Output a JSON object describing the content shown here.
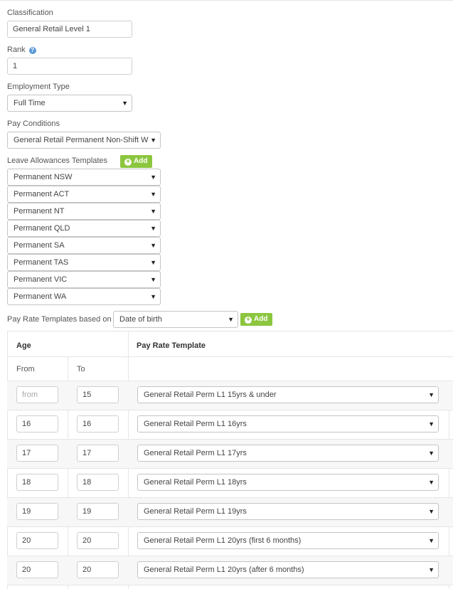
{
  "classification": {
    "label": "Classification",
    "value": "General Retail Level 1"
  },
  "rank": {
    "label": "Rank",
    "help_icon": "?",
    "value": "1"
  },
  "employment_type": {
    "label": "Employment Type",
    "value": "Full Time"
  },
  "pay_conditions": {
    "label": "Pay Conditions",
    "value": "General Retail Permanent Non-Shift W"
  },
  "leave_allowances": {
    "label": "Leave Allowances Templates",
    "add_label": "Add",
    "items": [
      "Permanent NSW",
      "Permanent ACT",
      "Permanent NT",
      "Permanent QLD",
      "Permanent SA",
      "Permanent TAS",
      "Permanent VIC",
      "Permanent WA"
    ]
  },
  "pay_rate_basis": {
    "label": "Pay Rate Templates based on",
    "value": "Date of birth",
    "add_label": "Add"
  },
  "pay_rate_table": {
    "headers": {
      "age": "Age",
      "template": "Pay Rate Template",
      "from": "From",
      "to": "To"
    },
    "from_placeholder": "from",
    "rows": [
      {
        "from": "",
        "to": "15",
        "template": "General Retail Perm L1 15yrs & under"
      },
      {
        "from": "16",
        "to": "16",
        "template": "General Retail Perm L1 16yrs"
      },
      {
        "from": "17",
        "to": "17",
        "template": "General Retail Perm L1 17yrs"
      },
      {
        "from": "18",
        "to": "18",
        "template": "General Retail Perm L1 18yrs"
      },
      {
        "from": "19",
        "to": "19",
        "template": "General Retail Perm L1 19yrs"
      },
      {
        "from": "20",
        "to": "20",
        "template": "General Retail Perm L1 20yrs (first 6 months)"
      },
      {
        "from": "20",
        "to": "20",
        "template": "General Retail Perm L1 20yrs (after 6 months)"
      }
    ]
  },
  "icons": {
    "dropdown_arrow": "▼",
    "add_plus": "+"
  },
  "colors": {
    "add_button": "#8cc63f",
    "help_icon": "#5b9ad8"
  }
}
